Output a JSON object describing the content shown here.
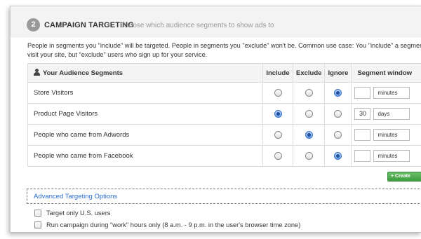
{
  "step": {
    "number": "2",
    "title": "CAMPAIGN TARGETING",
    "subtitle": "Choose which audience segments to show ads to"
  },
  "intro": {
    "line1": "People in segments you \"include\" will be targeted. People in segments you \"exclude\" won't be. Common use case: You \"include\" a segment c",
    "line2": "visit your site, but \"exclude\" users who sign up for your service."
  },
  "table": {
    "headers": {
      "segments": "Your Audience Segments",
      "include": "Include",
      "exclude": "Exclude",
      "ignore": "Ignore",
      "window": "Segment window"
    },
    "rows": [
      {
        "name": "Store Visitors",
        "selected": "ignore",
        "window_value": "",
        "window_unit": "minutes"
      },
      {
        "name": "Product Page Visitors",
        "selected": "include",
        "window_value": "30",
        "window_unit": "days"
      },
      {
        "name": "People who came from Adwords",
        "selected": "exclude",
        "window_value": "",
        "window_unit": "minutes"
      },
      {
        "name": "People who came from Facebook",
        "selected": "ignore",
        "window_value": "",
        "window_unit": "minutes"
      }
    ]
  },
  "create_button": "+ Create",
  "advanced": {
    "link": "Advanced Targeting Options",
    "options": [
      {
        "label": "Target only U.S. users",
        "checked": false
      },
      {
        "label": "Run campaign during \"work\" hours only (8 a.m. - 9 p.m. in the user's browser time zone)",
        "checked": false
      }
    ]
  }
}
